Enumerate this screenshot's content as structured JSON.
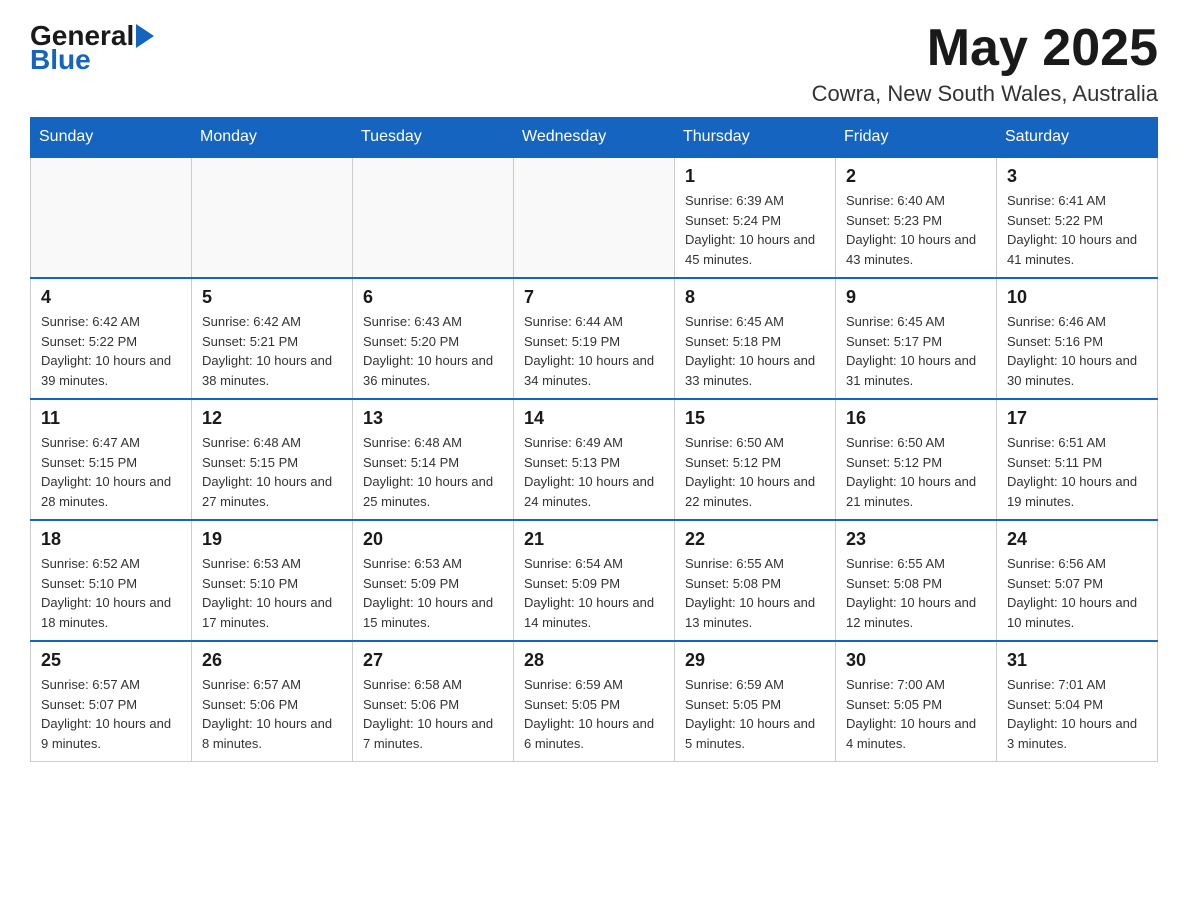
{
  "header": {
    "logo_general": "General",
    "logo_blue": "Blue",
    "month_title": "May 2025",
    "location": "Cowra, New South Wales, Australia"
  },
  "days_of_week": [
    "Sunday",
    "Monday",
    "Tuesday",
    "Wednesday",
    "Thursday",
    "Friday",
    "Saturday"
  ],
  "weeks": [
    [
      {
        "day": "",
        "info": ""
      },
      {
        "day": "",
        "info": ""
      },
      {
        "day": "",
        "info": ""
      },
      {
        "day": "",
        "info": ""
      },
      {
        "day": "1",
        "info": "Sunrise: 6:39 AM\nSunset: 5:24 PM\nDaylight: 10 hours and 45 minutes."
      },
      {
        "day": "2",
        "info": "Sunrise: 6:40 AM\nSunset: 5:23 PM\nDaylight: 10 hours and 43 minutes."
      },
      {
        "day": "3",
        "info": "Sunrise: 6:41 AM\nSunset: 5:22 PM\nDaylight: 10 hours and 41 minutes."
      }
    ],
    [
      {
        "day": "4",
        "info": "Sunrise: 6:42 AM\nSunset: 5:22 PM\nDaylight: 10 hours and 39 minutes."
      },
      {
        "day": "5",
        "info": "Sunrise: 6:42 AM\nSunset: 5:21 PM\nDaylight: 10 hours and 38 minutes."
      },
      {
        "day": "6",
        "info": "Sunrise: 6:43 AM\nSunset: 5:20 PM\nDaylight: 10 hours and 36 minutes."
      },
      {
        "day": "7",
        "info": "Sunrise: 6:44 AM\nSunset: 5:19 PM\nDaylight: 10 hours and 34 minutes."
      },
      {
        "day": "8",
        "info": "Sunrise: 6:45 AM\nSunset: 5:18 PM\nDaylight: 10 hours and 33 minutes."
      },
      {
        "day": "9",
        "info": "Sunrise: 6:45 AM\nSunset: 5:17 PM\nDaylight: 10 hours and 31 minutes."
      },
      {
        "day": "10",
        "info": "Sunrise: 6:46 AM\nSunset: 5:16 PM\nDaylight: 10 hours and 30 minutes."
      }
    ],
    [
      {
        "day": "11",
        "info": "Sunrise: 6:47 AM\nSunset: 5:15 PM\nDaylight: 10 hours and 28 minutes."
      },
      {
        "day": "12",
        "info": "Sunrise: 6:48 AM\nSunset: 5:15 PM\nDaylight: 10 hours and 27 minutes."
      },
      {
        "day": "13",
        "info": "Sunrise: 6:48 AM\nSunset: 5:14 PM\nDaylight: 10 hours and 25 minutes."
      },
      {
        "day": "14",
        "info": "Sunrise: 6:49 AM\nSunset: 5:13 PM\nDaylight: 10 hours and 24 minutes."
      },
      {
        "day": "15",
        "info": "Sunrise: 6:50 AM\nSunset: 5:12 PM\nDaylight: 10 hours and 22 minutes."
      },
      {
        "day": "16",
        "info": "Sunrise: 6:50 AM\nSunset: 5:12 PM\nDaylight: 10 hours and 21 minutes."
      },
      {
        "day": "17",
        "info": "Sunrise: 6:51 AM\nSunset: 5:11 PM\nDaylight: 10 hours and 19 minutes."
      }
    ],
    [
      {
        "day": "18",
        "info": "Sunrise: 6:52 AM\nSunset: 5:10 PM\nDaylight: 10 hours and 18 minutes."
      },
      {
        "day": "19",
        "info": "Sunrise: 6:53 AM\nSunset: 5:10 PM\nDaylight: 10 hours and 17 minutes."
      },
      {
        "day": "20",
        "info": "Sunrise: 6:53 AM\nSunset: 5:09 PM\nDaylight: 10 hours and 15 minutes."
      },
      {
        "day": "21",
        "info": "Sunrise: 6:54 AM\nSunset: 5:09 PM\nDaylight: 10 hours and 14 minutes."
      },
      {
        "day": "22",
        "info": "Sunrise: 6:55 AM\nSunset: 5:08 PM\nDaylight: 10 hours and 13 minutes."
      },
      {
        "day": "23",
        "info": "Sunrise: 6:55 AM\nSunset: 5:08 PM\nDaylight: 10 hours and 12 minutes."
      },
      {
        "day": "24",
        "info": "Sunrise: 6:56 AM\nSunset: 5:07 PM\nDaylight: 10 hours and 10 minutes."
      }
    ],
    [
      {
        "day": "25",
        "info": "Sunrise: 6:57 AM\nSunset: 5:07 PM\nDaylight: 10 hours and 9 minutes."
      },
      {
        "day": "26",
        "info": "Sunrise: 6:57 AM\nSunset: 5:06 PM\nDaylight: 10 hours and 8 minutes."
      },
      {
        "day": "27",
        "info": "Sunrise: 6:58 AM\nSunset: 5:06 PM\nDaylight: 10 hours and 7 minutes."
      },
      {
        "day": "28",
        "info": "Sunrise: 6:59 AM\nSunset: 5:05 PM\nDaylight: 10 hours and 6 minutes."
      },
      {
        "day": "29",
        "info": "Sunrise: 6:59 AM\nSunset: 5:05 PM\nDaylight: 10 hours and 5 minutes."
      },
      {
        "day": "30",
        "info": "Sunrise: 7:00 AM\nSunset: 5:05 PM\nDaylight: 10 hours and 4 minutes."
      },
      {
        "day": "31",
        "info": "Sunrise: 7:01 AM\nSunset: 5:04 PM\nDaylight: 10 hours and 3 minutes."
      }
    ]
  ]
}
